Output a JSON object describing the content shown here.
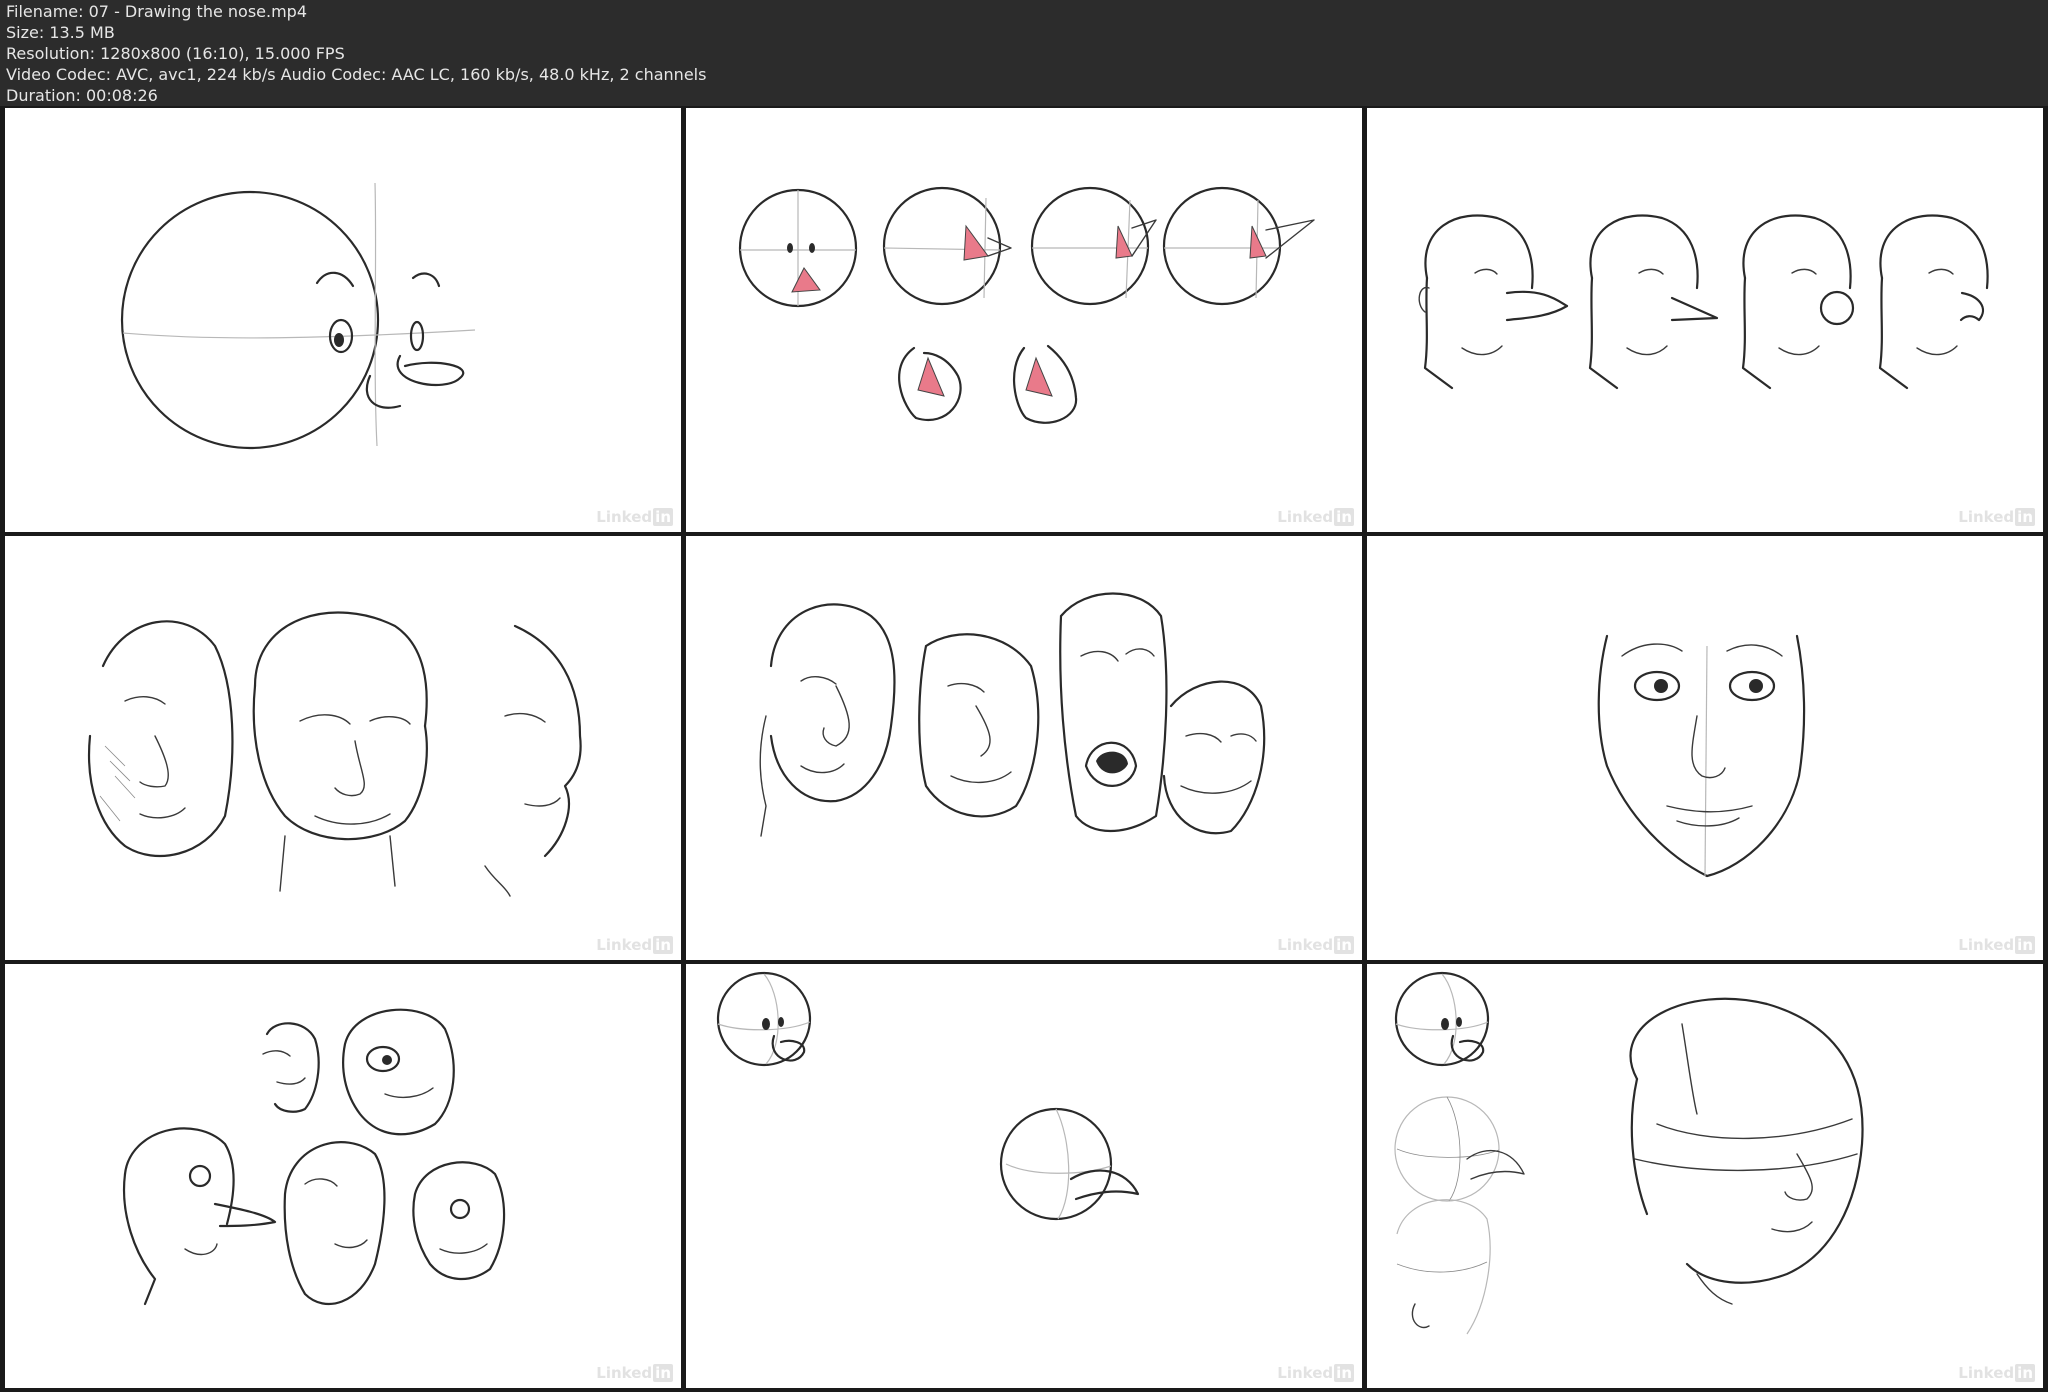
{
  "header": {
    "filename": "Filename: 07 - Drawing the nose.mp4",
    "size": "Size: 13.5 MB",
    "resolution": "Resolution: 1280x800 (16:10), 15.000 FPS",
    "codecs": "Video Codec: AVC, avc1, 224 kb/s Audio Codec: AAC LC, 160 kb/s, 48.0 kHz, 2 channels",
    "duration": "Duration: 00:08:26"
  },
  "watermark": {
    "brand": "Linked",
    "badge": "in"
  },
  "thumbnails": [
    {
      "name": "thumbnail-1"
    },
    {
      "name": "thumbnail-2"
    },
    {
      "name": "thumbnail-3"
    },
    {
      "name": "thumbnail-4"
    },
    {
      "name": "thumbnail-5"
    },
    {
      "name": "thumbnail-6"
    },
    {
      "name": "thumbnail-7"
    },
    {
      "name": "thumbnail-8"
    },
    {
      "name": "thumbnail-9"
    }
  ]
}
